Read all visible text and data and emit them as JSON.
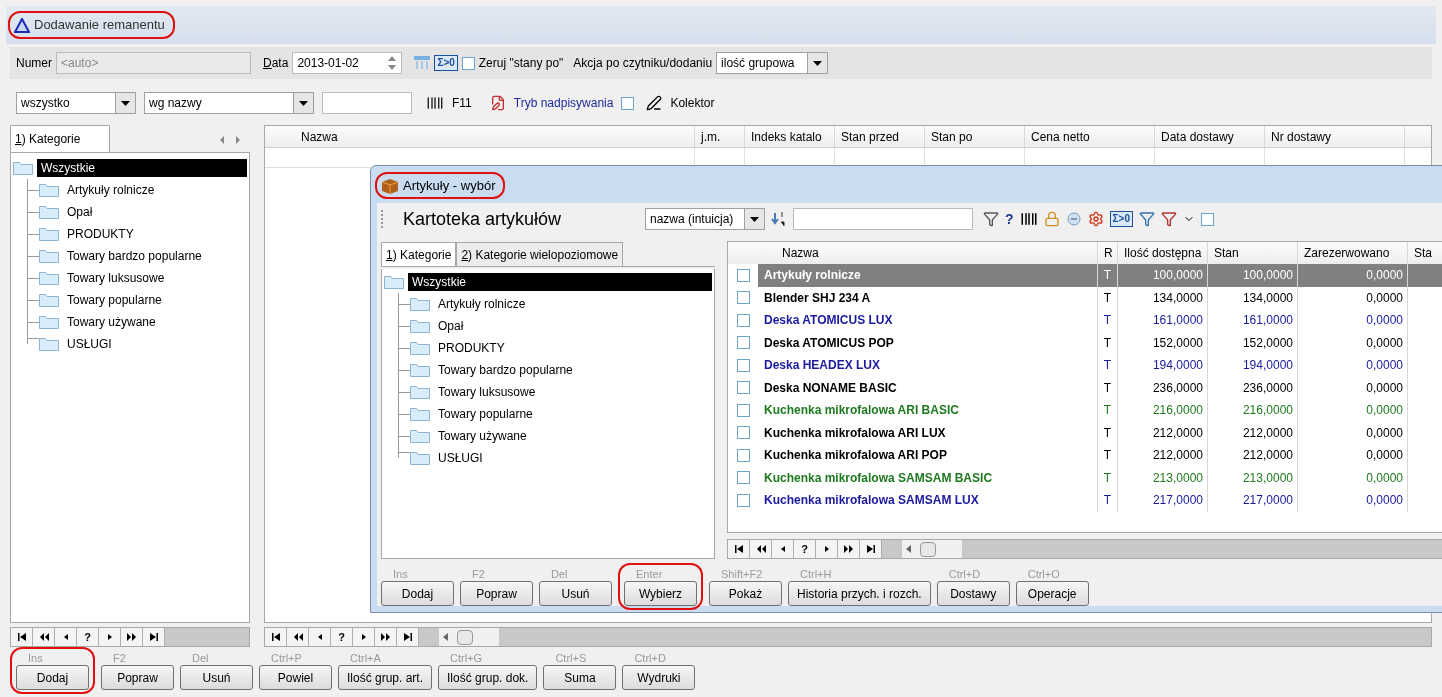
{
  "window": {
    "title": "Dodawanie remanentu",
    "annotated": true
  },
  "toolbar": {
    "number_label": "Numer",
    "number_placeholder": "<auto>",
    "date_label": "Data",
    "date_value": "2013-01-02",
    "sum_badge": "Σ>0",
    "zero_checkbox": {
      "label": "Zeruj \"stany po\"",
      "checked": false
    },
    "action_label": "Akcja po czytniku/dodaniu",
    "action_value": "ilość grupowa"
  },
  "filter": {
    "scope": "wszystko",
    "sort": "wg nazwy",
    "key": "F11",
    "overwrite_mode": {
      "label": "Tryb nadpisywania",
      "checked": false
    },
    "collector": "Kolektor"
  },
  "left_panel": {
    "tab": {
      "label": "1) Kategorie",
      "selected": true
    },
    "tree": {
      "label": "Wszystkie",
      "selected": true,
      "children": [
        {
          "label": "Artykuły rolnicze",
          "selected": false
        },
        {
          "label": "Opał",
          "selected": false
        },
        {
          "label": "PRODUKTY",
          "selected": false
        },
        {
          "label": "Towary bardzo popularne",
          "selected": false
        },
        {
          "label": "Towary luksusowe",
          "selected": false
        },
        {
          "label": "Towary popularne",
          "selected": false
        },
        {
          "label": "Towary używane",
          "selected": false
        },
        {
          "label": "USŁUGI",
          "selected": false
        }
      ]
    }
  },
  "nav_help": "?",
  "table": {
    "columns": [
      "Nazwa",
      "j.m.",
      "Indeks katalo",
      "Stan przed",
      "Stan po",
      "Cena netto",
      "Data dostawy",
      "Nr dostawy"
    ]
  },
  "buttons": [
    {
      "shortcut": "Ins",
      "label": "Dodaj",
      "annotated": true
    },
    {
      "shortcut": "F2",
      "label": "Popraw",
      "annotated": false
    },
    {
      "shortcut": "Del",
      "label": "Usuń",
      "annotated": false
    },
    {
      "shortcut": "Ctrl+P",
      "label": "Powiel",
      "annotated": false
    },
    {
      "shortcut": "Ctrl+A",
      "label": "Ilość grup. art.",
      "annotated": false
    },
    {
      "shortcut": "Ctrl+G",
      "label": "Ilość grup. dok.",
      "annotated": false
    },
    {
      "shortcut": "Ctrl+S",
      "label": "Suma",
      "annotated": false
    },
    {
      "shortcut": "Ctrl+D",
      "label": "Wydruki",
      "annotated": false
    }
  ],
  "dialog": {
    "title": "Artykuły - wybór",
    "annotated": true,
    "header": "Kartoteka artykułów",
    "sort": "nazwa (intuicja)",
    "help": "?",
    "sum_badge": "Σ>0",
    "option_checked": false,
    "tabs": [
      {
        "label": "1) Kategorie",
        "selected": true
      },
      {
        "label": "2) Kategorie wielopoziomowe",
        "selected": false
      }
    ],
    "tree": {
      "label": "Wszystkie",
      "selected": true,
      "children": [
        {
          "label": "Artykuły rolnicze",
          "selected": false
        },
        {
          "label": "Opał",
          "selected": false
        },
        {
          "label": "PRODUKTY",
          "selected": false
        },
        {
          "label": "Towary bardzo popularne",
          "selected": false
        },
        {
          "label": "Towary luksusowe",
          "selected": false
        },
        {
          "label": "Towary popularne",
          "selected": false
        },
        {
          "label": "Towary używane",
          "selected": false
        },
        {
          "label": "USŁUGI",
          "selected": false
        }
      ]
    },
    "columns": [
      "Nazwa",
      "R",
      "Ilość dostępna",
      "Stan",
      "Zarezerwowano",
      "Sta"
    ],
    "rows": [
      {
        "name": "Artykuły rolnicze",
        "r": "T",
        "available": "100,0000",
        "stock": "100,0000",
        "reserved": "0,0000",
        "selected": true,
        "checked": false
      },
      {
        "name": "Blender SHJ 234 A",
        "r": "T",
        "available": "134,0000",
        "stock": "134,0000",
        "reserved": "0,0000",
        "color": "#000000",
        "selected": false,
        "checked": false
      },
      {
        "name": "Deska ATOMICUS LUX",
        "r": "T",
        "available": "161,0000",
        "stock": "161,0000",
        "reserved": "0,0000",
        "color": "#1a1aa0",
        "selected": false,
        "checked": false
      },
      {
        "name": "Deska ATOMICUS POP",
        "r": "T",
        "available": "152,0000",
        "stock": "152,0000",
        "reserved": "0,0000",
        "color": "#000000",
        "selected": false,
        "checked": false
      },
      {
        "name": "Deska HEADEX LUX",
        "r": "T",
        "available": "194,0000",
        "stock": "194,0000",
        "reserved": "0,0000",
        "color": "#1a1aa0",
        "selected": false,
        "checked": false
      },
      {
        "name": "Deska NONAME BASIC",
        "r": "T",
        "available": "236,0000",
        "stock": "236,0000",
        "reserved": "0,0000",
        "color": "#000000",
        "selected": false,
        "checked": false
      },
      {
        "name": "Kuchenka mikrofalowa ARI BASIC",
        "r": "T",
        "available": "216,0000",
        "stock": "216,0000",
        "reserved": "0,0000",
        "color": "#1e7a1e",
        "selected": false,
        "checked": false
      },
      {
        "name": "Kuchenka mikrofalowa ARI LUX",
        "r": "T",
        "available": "212,0000",
        "stock": "212,0000",
        "reserved": "0,0000",
        "color": "#000000",
        "selected": false,
        "checked": false
      },
      {
        "name": "Kuchenka mikrofalowa ARI POP",
        "r": "T",
        "available": "212,0000",
        "stock": "212,0000",
        "reserved": "0,0000",
        "color": "#000000",
        "selected": false,
        "checked": false
      },
      {
        "name": "Kuchenka mikrofalowa SAMSAM BASIC",
        "r": "T",
        "available": "213,0000",
        "stock": "213,0000",
        "reserved": "0,0000",
        "color": "#1e7a1e",
        "selected": false,
        "checked": false
      },
      {
        "name": "Kuchenka mikrofalowa SAMSAM LUX",
        "r": "T",
        "available": "217,0000",
        "stock": "217,0000",
        "reserved": "0,0000",
        "color": "#1a1aa0",
        "selected": false,
        "checked": false
      }
    ],
    "buttons": [
      {
        "shortcut": "Ins",
        "label": "Dodaj",
        "annotated": false
      },
      {
        "shortcut": "F2",
        "label": "Popraw",
        "annotated": false
      },
      {
        "shortcut": "Del",
        "label": "Usuń",
        "annotated": false
      },
      {
        "shortcut": "Enter",
        "label": "Wybierz",
        "annotated": true
      },
      {
        "shortcut": "Shift+F2",
        "label": "Pokaż",
        "annotated": false
      },
      {
        "shortcut": "Ctrl+H",
        "label": "Historia przych. i rozch.",
        "annotated": false
      },
      {
        "shortcut": "Ctrl+D",
        "label": "Dostawy",
        "annotated": false
      },
      {
        "shortcut": "Ctrl+O",
        "label": "Operacje",
        "annotated": false
      }
    ]
  }
}
